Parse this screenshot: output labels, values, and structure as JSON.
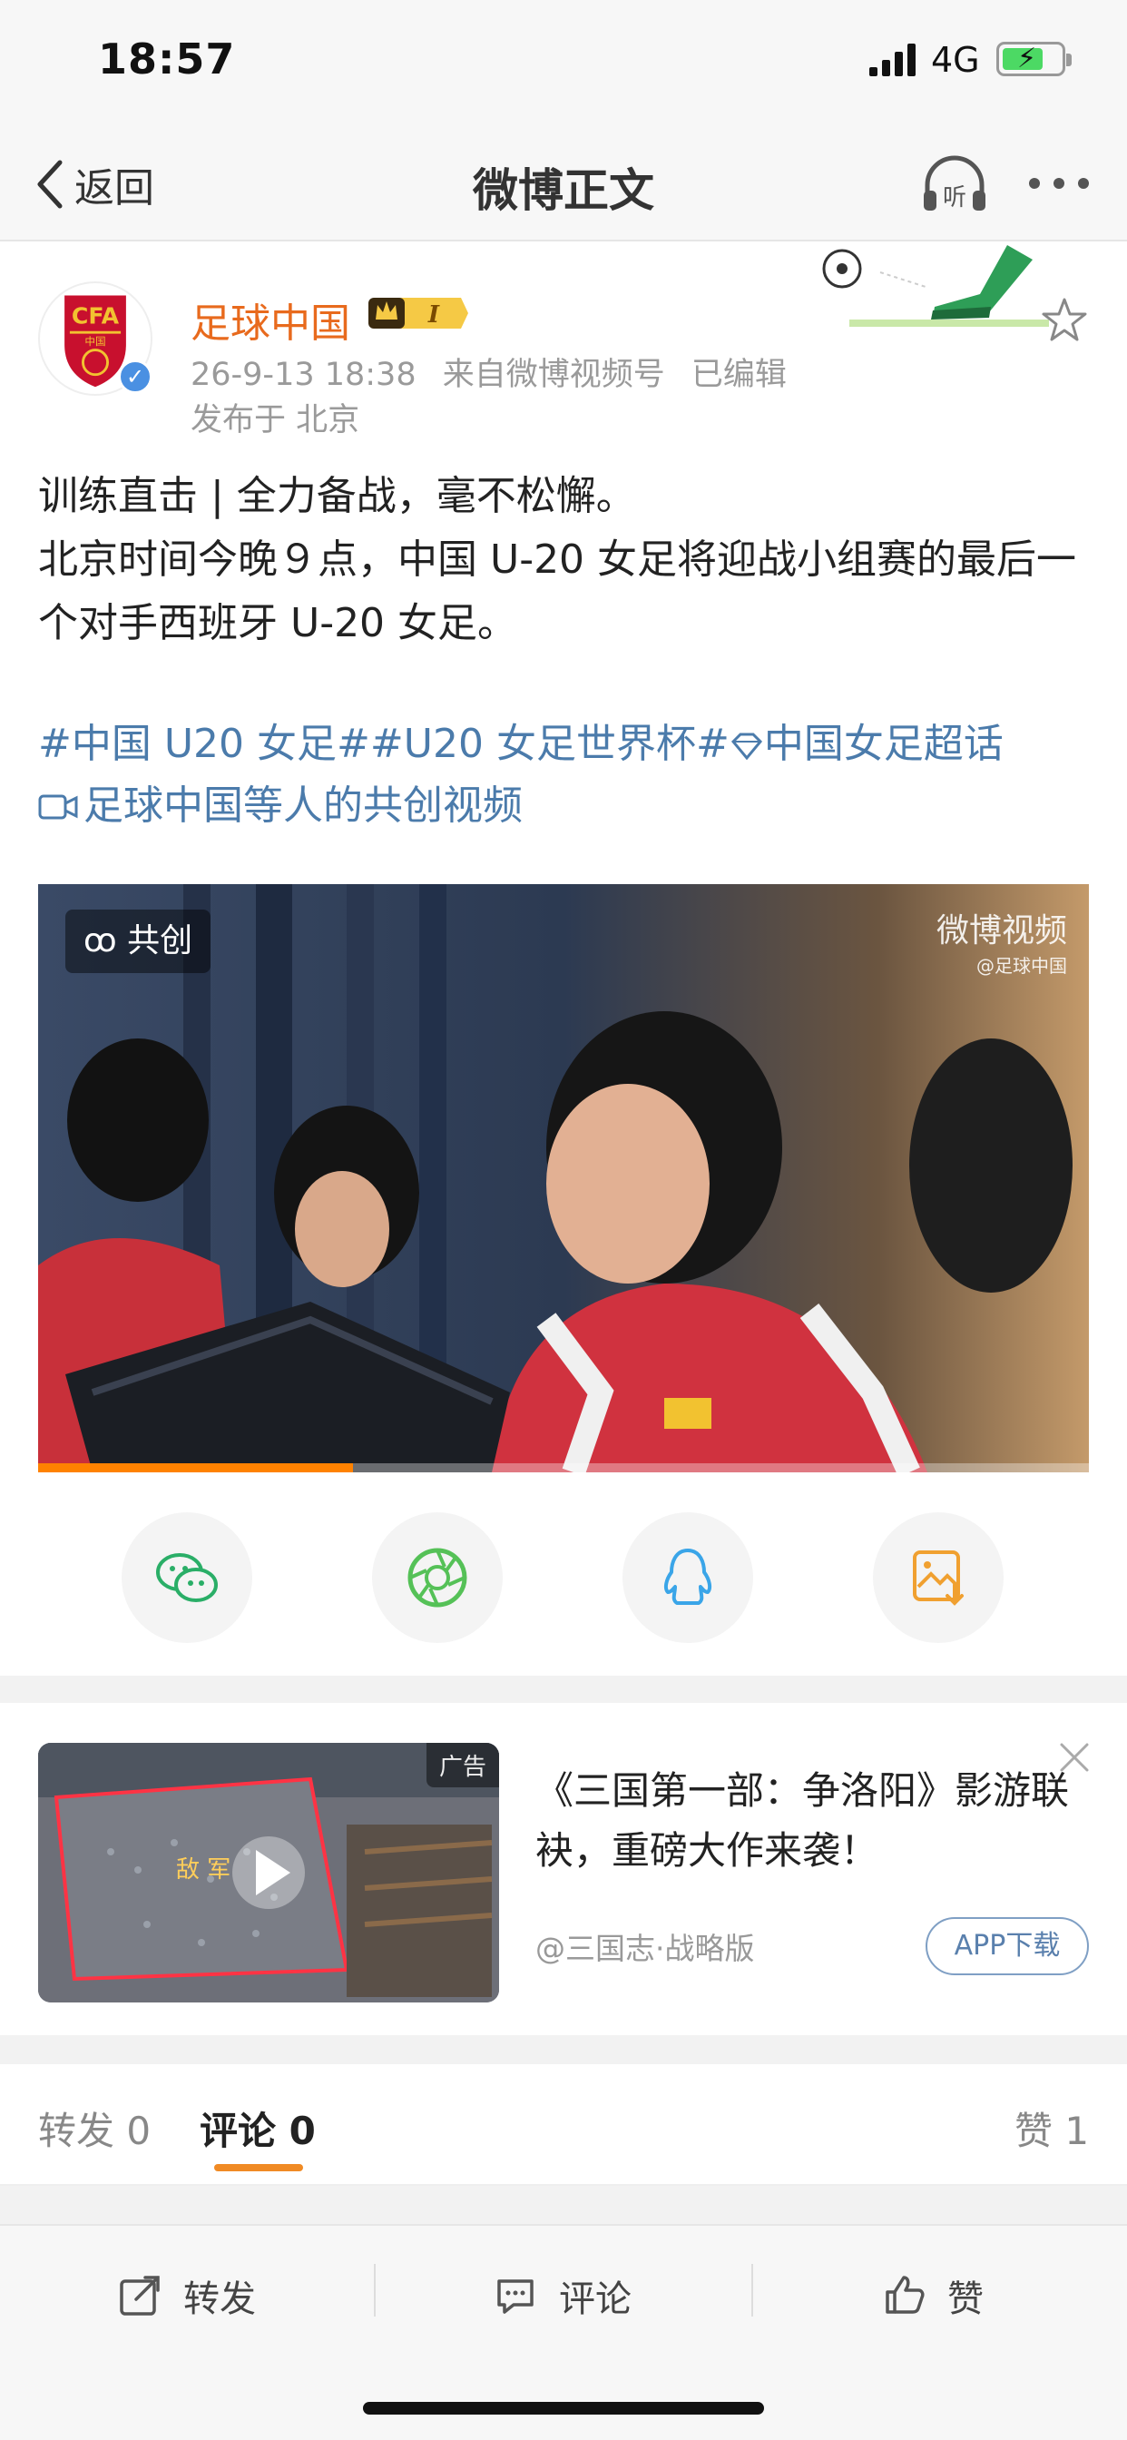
{
  "status_bar": {
    "time": "18:57",
    "network": "4G",
    "battery_icon": "battery-charging-icon"
  },
  "nav": {
    "back_label": "返回",
    "title": "微博正文",
    "listen_label": "听"
  },
  "post": {
    "username": "足球中国",
    "vip_badge": "I",
    "avatar_text": "CFA",
    "avatar_sub": "中国",
    "meta": {
      "time": "26-9-13 18:38",
      "source": "来自微博视频号",
      "edited": "已编辑"
    },
    "location": "发布于 北京",
    "content": [
      "训练直击 | 全力备战，毫不松懈。",
      "北京时间今晚９点，中国 U-20 女足将迎战小组赛的最后一个对手西班牙 U-20 女足。"
    ],
    "tags": [
      "#中国 U20 女足#",
      "#U20 女足世界杯#",
      "中国女足超话"
    ],
    "cocreate_text": "足球中国等人的共创视频",
    "video": {
      "badge": "共创",
      "watermark_brand": "微博视频",
      "watermark_user": "@足球中国",
      "progress": 0.3
    }
  },
  "share_buttons": [
    {
      "name": "wechat-icon",
      "color": "#2aae67"
    },
    {
      "name": "moments-icon",
      "color": "#55c157"
    },
    {
      "name": "qq-icon",
      "color": "#3aa5e8"
    },
    {
      "name": "save-image-icon",
      "color": "#f0a030"
    }
  ],
  "ad": {
    "label": "广告",
    "title": "《三国第一部：争洛阳》影游联袂，重磅大作来袭！",
    "source": "@三国志·战略版",
    "button": "APP下载",
    "thumb_text": "敌 军"
  },
  "tabs": {
    "repost": "转发 0",
    "comment": "评论 0",
    "like": "赞 1"
  },
  "actions": {
    "repost": "转发",
    "comment": "评论",
    "like": "赞"
  },
  "colors": {
    "accent": "#ff8200",
    "link": "#4b7bab",
    "username": "#e86a1d"
  }
}
